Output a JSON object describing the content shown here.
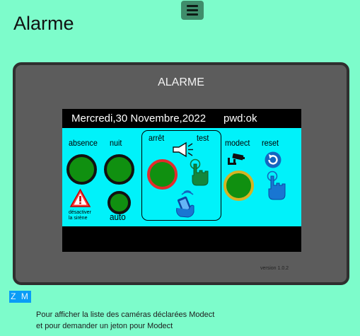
{
  "header": {
    "menu_icon": "hamburger-menu-icon",
    "title": "Alarme"
  },
  "panel": {
    "title": "ALARME",
    "version": "version 1.0.2",
    "screen": {
      "date_text": "Mercredi,30 Novembre,2022",
      "pwd_status": "pwd:ok",
      "labels": {
        "absence": "absence",
        "nuit": "nuit",
        "arret": "arrêt",
        "test": "test",
        "modect": "modect",
        "reset": "reset",
        "auto": "auto",
        "siren_line1": "désactiver",
        "siren_line2": "la sirène"
      },
      "icons": [
        "warning-icon",
        "megaphone-icon",
        "touch-hand-icon",
        "phone-hand-icon",
        "camera-icon",
        "reset-icon"
      ],
      "colors": {
        "screen_background": "#00f2fa",
        "button_fill": "#109010",
        "arret_ring": "#e32c2c",
        "modect_ring": "#d6b322",
        "reset_blue": "#1565c0"
      }
    }
  },
  "footer": {
    "zm_button": "Z M",
    "info_line1": "Pour afficher la liste des caméras déclarées Modect",
    "info_line2": "et pour demander un jeton pour Modect"
  }
}
